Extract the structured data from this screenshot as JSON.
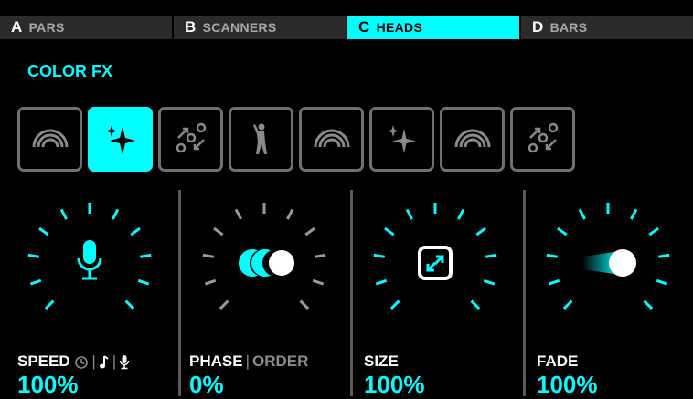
{
  "tabs": [
    {
      "letter": "A",
      "name": "PARS",
      "active": false
    },
    {
      "letter": "B",
      "name": "SCANNERS",
      "active": false
    },
    {
      "letter": "C",
      "name": "HEADS",
      "active": true
    },
    {
      "letter": "D",
      "name": "BARS",
      "active": false
    }
  ],
  "section_title": "COLOR FX",
  "presets": [
    {
      "icon": "rainbow-icon",
      "active": false
    },
    {
      "icon": "sparkle-icon",
      "active": true
    },
    {
      "icon": "random-dots-icon",
      "active": false
    },
    {
      "icon": "dancer-icon",
      "active": false
    },
    {
      "icon": "rainbow-icon",
      "active": false
    },
    {
      "icon": "sparkle-icon",
      "active": false
    },
    {
      "icon": "rainbow-icon",
      "active": false
    },
    {
      "icon": "random-dots-icon",
      "active": false
    }
  ],
  "knobs": {
    "speed": {
      "label": "SPEED",
      "value": "100%",
      "center_icon": "microphone-icon",
      "modes": [
        "clock-icon",
        "note-icon",
        "microphone-icon"
      ]
    },
    "phase": {
      "label": "PHASE",
      "alt_label": "ORDER",
      "separator": "|",
      "value": "0%",
      "center_icon": "phase-icon"
    },
    "size": {
      "label": "SIZE",
      "value": "100%",
      "center_icon": "expand-icon"
    },
    "fade": {
      "label": "FADE",
      "value": "100%",
      "center_icon": "fade-icon"
    }
  },
  "colors": {
    "accent": "#00ffff",
    "tab_inactive": "#2b2b2b",
    "tick_inactive": "#9a9a9a",
    "border": "#707070"
  }
}
